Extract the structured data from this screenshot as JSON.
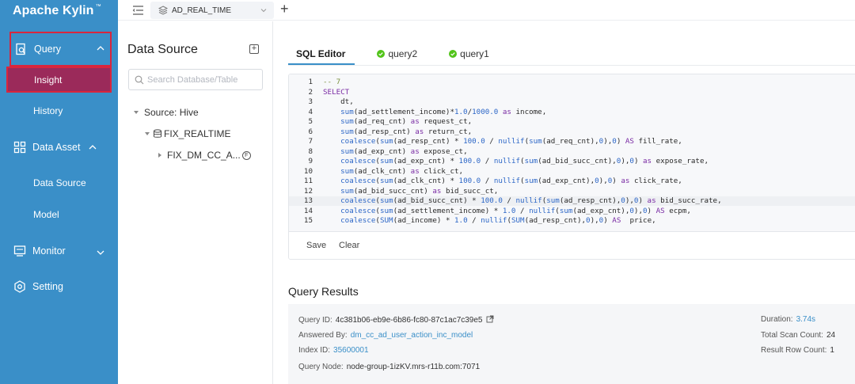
{
  "app": {
    "brand": "Apache Kylin",
    "brand_mark": "™"
  },
  "nav": {
    "query": {
      "label": "Query",
      "icon": "query-icon"
    },
    "insight": {
      "label": "Insight"
    },
    "history": {
      "label": "History"
    },
    "data_asset": {
      "label": "Data Asset",
      "icon": "data-asset-icon"
    },
    "data_source": {
      "label": "Data Source"
    },
    "model": {
      "label": "Model"
    },
    "monitor": {
      "label": "Monitor",
      "icon": "monitor-icon"
    },
    "setting": {
      "label": "Setting",
      "icon": "setting-icon"
    }
  },
  "topbar": {
    "project": "AD_REAL_TIME",
    "add_label": "+"
  },
  "data_source_panel": {
    "title": "Data Source",
    "search_placeholder": "Search Database/Table",
    "tree": {
      "source": "Source: Hive",
      "database": "FIX_REALTIME",
      "table": "FIX_DM_CC_A...",
      "table_badge": "F"
    }
  },
  "tabs": [
    {
      "label": "SQL Editor",
      "active": true
    },
    {
      "label": "query2",
      "status": "success"
    },
    {
      "label": "query1",
      "status": "success"
    }
  ],
  "editor": {
    "lines": [
      {
        "n": "1",
        "text": "-- 7"
      },
      {
        "n": "2",
        "text": "SELECT"
      },
      {
        "n": "3",
        "text": "    dt,"
      },
      {
        "n": "4",
        "text": "    sum(ad_settlement_income)*1.0/1000.0 as income,"
      },
      {
        "n": "5",
        "text": "    sum(ad_req_cnt) as request_ct,"
      },
      {
        "n": "6",
        "text": "    sum(ad_resp_cnt) as return_ct,"
      },
      {
        "n": "7",
        "text": "    coalesce(sum(ad_resp_cnt) * 100.0 / nullif(sum(ad_req_cnt),0),0) AS fill_rate,"
      },
      {
        "n": "8",
        "text": "    sum(ad_exp_cnt) as expose_ct,"
      },
      {
        "n": "9",
        "text": "    coalesce(sum(ad_exp_cnt) * 100.0 / nullif(sum(ad_bid_succ_cnt),0),0) as expose_rate,"
      },
      {
        "n": "10",
        "text": "    sum(ad_clk_cnt) as click_ct,"
      },
      {
        "n": "11",
        "text": "    coalesce(sum(ad_clk_cnt) * 100.0 / nullif(sum(ad_exp_cnt),0),0) as click_rate,"
      },
      {
        "n": "12",
        "text": "    sum(ad_bid_succ_cnt) as bid_succ_ct,"
      },
      {
        "n": "13",
        "text": "    coalesce(sum(ad_bid_succ_cnt) * 100.0 / nullif(sum(ad_resp_cnt),0),0) as bid_succ_rate,"
      },
      {
        "n": "14",
        "text": "    coalesce(sum(ad_settlement_income) * 1.0 / nullif(sum(ad_exp_cnt),0),0) AS ecpm,"
      },
      {
        "n": "15",
        "text": "    coalesce(SUM(ad_income) * 1.0 / nullif(SUM(ad_resp_cnt),0),0) AS  price,"
      }
    ],
    "save_label": "Save",
    "clear_label": "Clear"
  },
  "results": {
    "title": "Query Results",
    "query_id_label": "Query ID:",
    "query_id": "4c381b06-eb9e-6b86-fc80-87c1ac7c39e5",
    "answered_by_label": "Answered By:",
    "answered_by": "dm_cc_ad_user_action_inc_model",
    "index_id_label": "Index ID:",
    "index_id": "35600001",
    "query_node_label": "Query Node:",
    "query_node": "node-group-1izKV.mrs-r11b.com:7071",
    "duration_label": "Duration:",
    "duration": "3.74s",
    "total_scan_label": "Total Scan Count:",
    "total_scan": "24",
    "result_rows_label": "Result Row Count:",
    "result_rows": "1"
  },
  "colors": {
    "nav_bg": "#3a8fc8",
    "active_bg": "#9b2a5a",
    "highlight_border": "#d8263d",
    "accent": "#3a8fc8",
    "success": "#52c41a"
  }
}
